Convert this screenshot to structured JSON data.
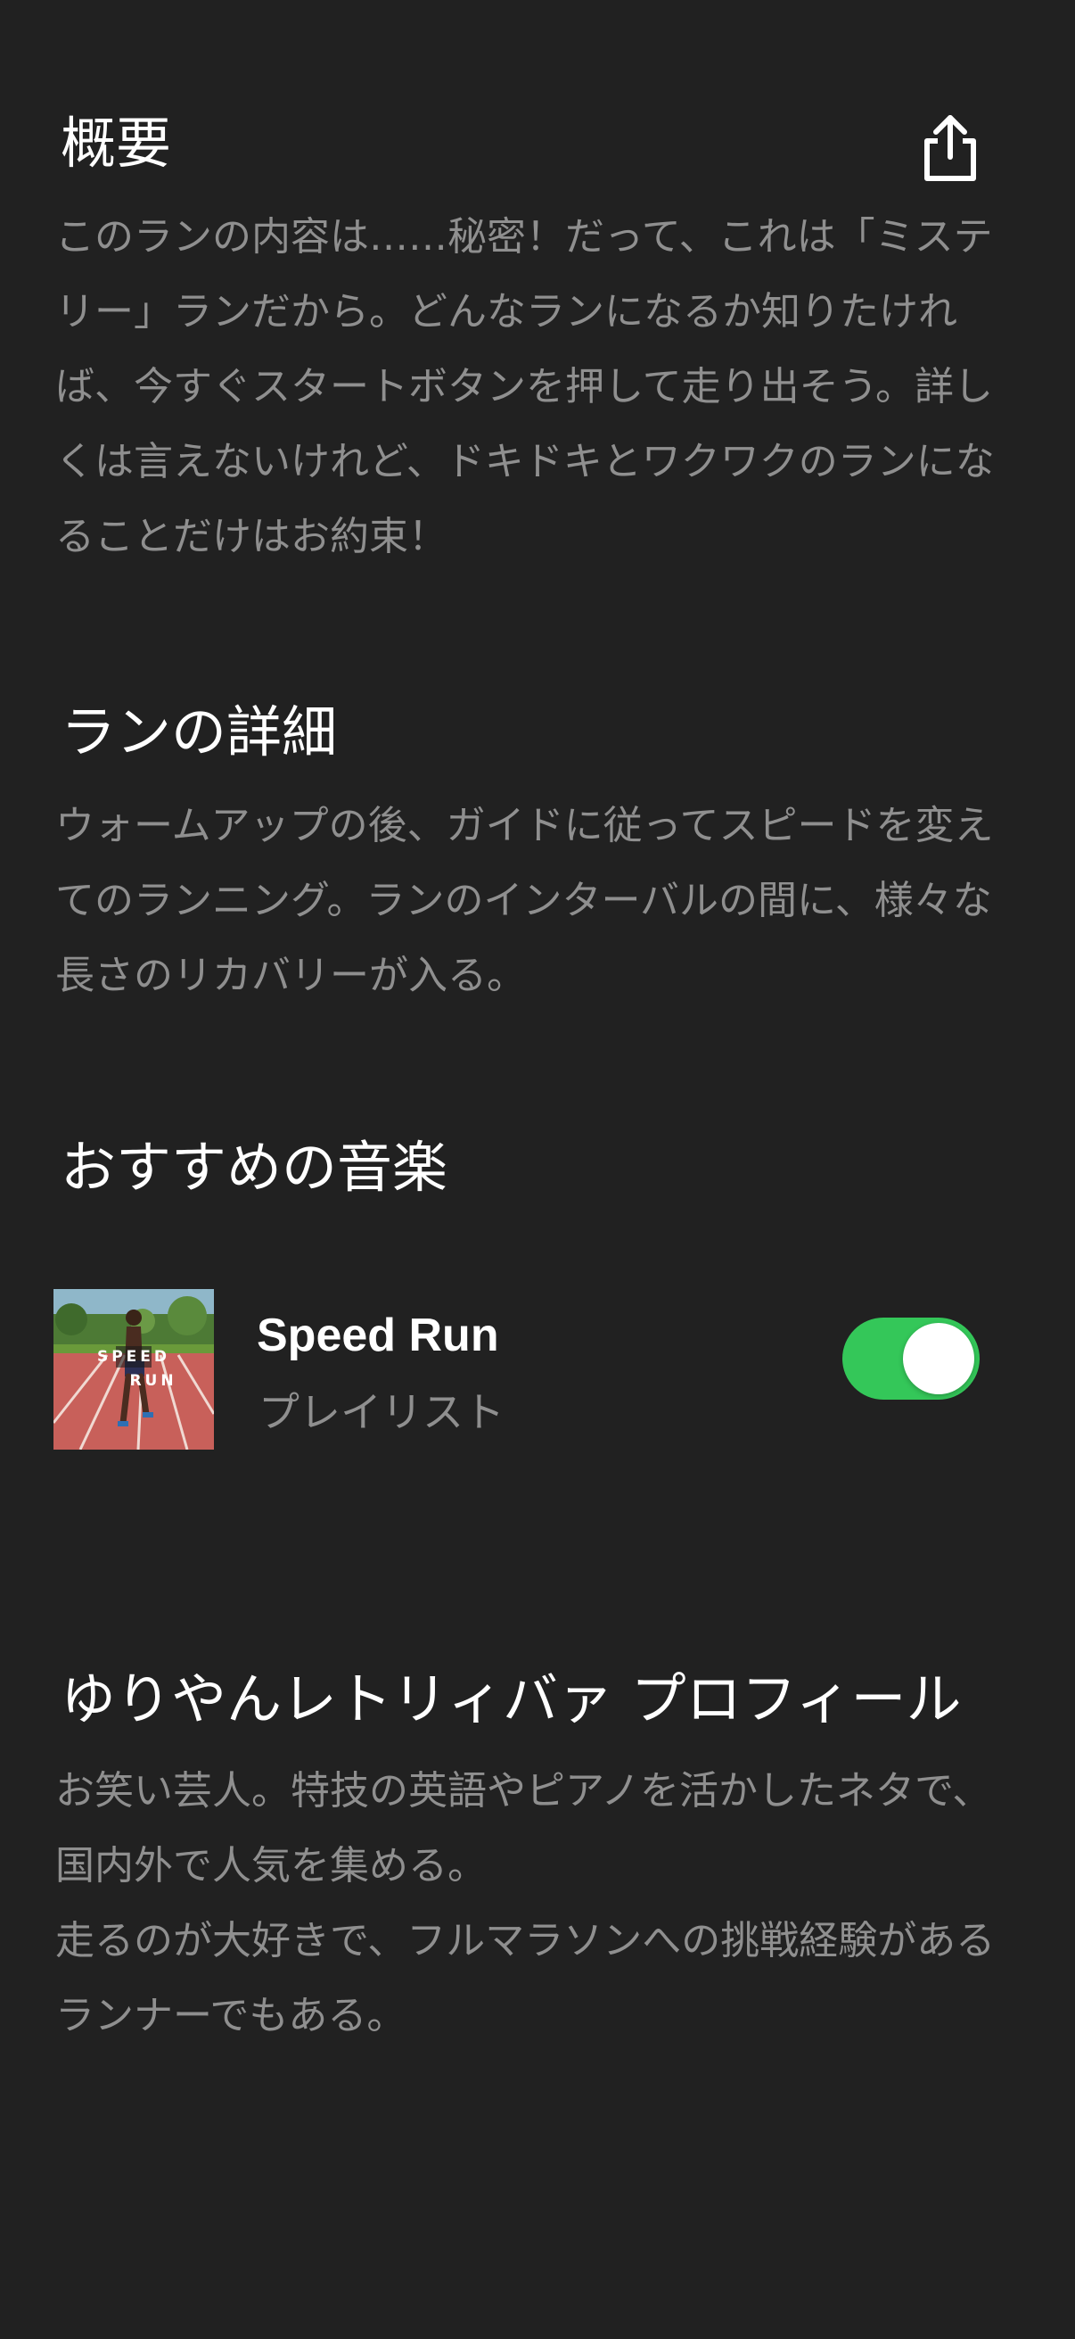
{
  "overview": {
    "title": "概要",
    "share_icon": "share-icon",
    "body": "このランの内容は……秘密！だって、これは「ミステリー」ランだから。どんなランになるか知りたければ、今すぐスタートボタンを押して走り出そう。詳しくは言えないけれど、ドキドキとワクワクのランになることだけはお約束！"
  },
  "run_details": {
    "title": "ランの詳細",
    "body": "ウォームアップの後、ガイドに従ってスピードを変えてのランニング。ランのインターバルの間に、様々な長さのリカバリーが入る。"
  },
  "recommended_music": {
    "title": "おすすめの音楽",
    "playlist": {
      "name": "Speed Run",
      "type": "プレイリスト",
      "cover_text_line1": "SPEED",
      "cover_text_line2": "RUN",
      "enabled": true,
      "toggle_color": "#34c759"
    }
  },
  "profile": {
    "title": "ゆりやんレトリィバァ プロフィール",
    "body": "お笑い芸人。特技の英語やピアノを活かしたネタで、国内外で人気を集める。\n走るのが大好きで、フルマラソンへの挑戦経験があるランナーでもある。"
  },
  "colors": {
    "background": "#212121",
    "heading": "#ffffff",
    "body_text": "#8f8f8f",
    "accent_green": "#34c759"
  }
}
